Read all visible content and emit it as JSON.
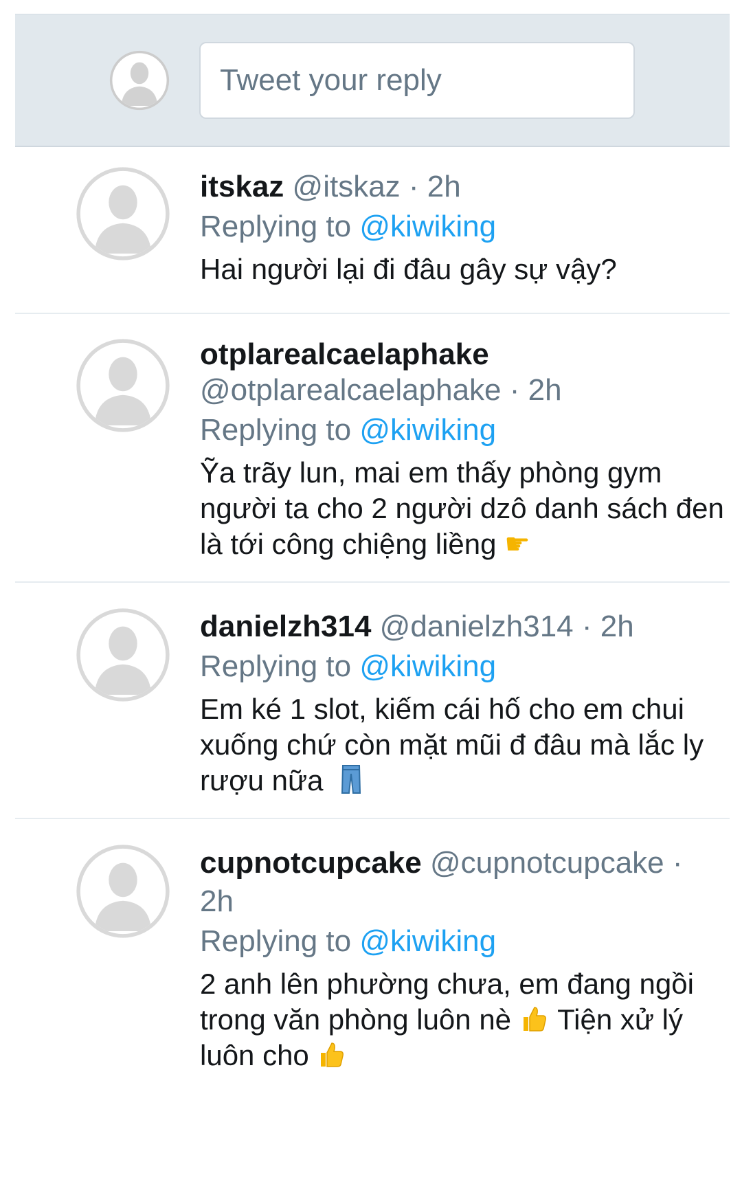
{
  "composer": {
    "placeholder": "Tweet your reply"
  },
  "tweets": [
    {
      "display_name": "itskaz",
      "handle": "@itskaz",
      "separator": "·",
      "time": "2h",
      "replying_prefix": "Replying to",
      "replying_to": "@kiwiking",
      "text": "Hai người lại đi đâu gây sự vậy?",
      "emoji_names": []
    },
    {
      "display_name": "otplarealcaelaphake",
      "handle": "@otplarealcaelaphake",
      "separator": "·",
      "time": "2h",
      "replying_prefix": "Replying to",
      "replying_to": "@kiwiking",
      "text": "Ỹa trãy lun, mai em thấy phòng gym người ta cho 2 người dzô danh sách đen là tới công chiệng liềng",
      "emoji_names": [
        "pointing-right-emoji"
      ]
    },
    {
      "display_name": "danielzh314",
      "handle": "@danielzh314",
      "separator": "·",
      "time": "2h",
      "replying_prefix": "Replying to",
      "replying_to": "@kiwiking",
      "text": "Em ké 1 slot, kiếm cái hố cho em chui xuống chứ còn mặt mũi đ đâu mà lắc ly rượu nữa",
      "emoji_names": [
        "jeans-emoji"
      ]
    },
    {
      "display_name": "cupnotcupcake",
      "handle": "@cupnotcupcake",
      "separator": "·",
      "time": "2h",
      "replying_prefix": "Replying to",
      "replying_to": "@kiwiking",
      "text_part1": "2 anh lên phường chưa, em đang ngồi trong văn phòng luôn nè",
      "text_part2": "Tiện xử lý luôn cho",
      "emoji_names": [
        "thumbs-up-emoji",
        "thumbs-up-emoji"
      ]
    }
  ],
  "colors": {
    "composer_bg": "#e1e8ed",
    "secondary_text": "#657786",
    "mention": "#1da1f2",
    "divider": "#e6ecf0",
    "avatar": "#d9d9d9"
  }
}
